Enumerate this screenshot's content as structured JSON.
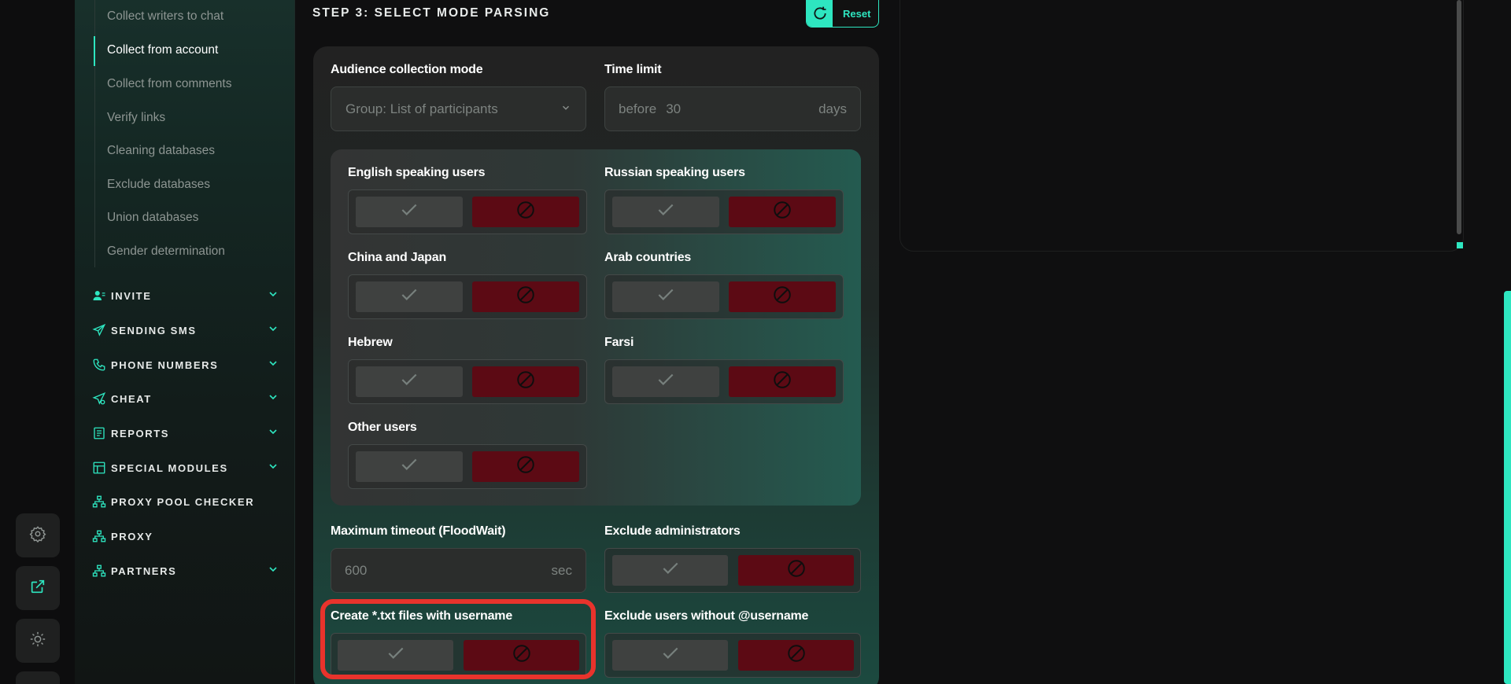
{
  "sidebar": {
    "sub_items": [
      {
        "label": "Collect writers to chat",
        "active": false
      },
      {
        "label": "Collect from account",
        "active": true
      },
      {
        "label": "Collect from comments",
        "active": false
      },
      {
        "label": "Verify links",
        "active": false
      },
      {
        "label": "Cleaning databases",
        "active": false
      },
      {
        "label": "Exclude databases",
        "active": false
      },
      {
        "label": "Union databases",
        "active": false
      },
      {
        "label": "Gender determination",
        "active": false
      }
    ],
    "sections": [
      {
        "label": "INVITE",
        "icon": "user-icon",
        "has_chevron": true
      },
      {
        "label": "SENDING SMS",
        "icon": "paper-plane-icon",
        "has_chevron": true
      },
      {
        "label": "PHONE NUMBERS",
        "icon": "phone-icon",
        "has_chevron": true
      },
      {
        "label": "CHEAT",
        "icon": "send-icon",
        "has_chevron": true
      },
      {
        "label": "REPORTS",
        "icon": "report-icon",
        "has_chevron": true
      },
      {
        "label": "SPECIAL MODULES",
        "icon": "modules-icon",
        "has_chevron": true
      },
      {
        "label": "PROXY POOL CHECKER",
        "icon": "network-icon",
        "has_chevron": false
      },
      {
        "label": "PROXY",
        "icon": "network-icon",
        "has_chevron": false
      },
      {
        "label": "PARTNERS",
        "icon": "network-icon",
        "has_chevron": true
      }
    ]
  },
  "rail": {
    "icons": [
      "gear-icon",
      "external-link-icon",
      "sun-icon"
    ]
  },
  "main": {
    "step_title": "STEP 3: SELECT MODE PARSING",
    "reset_label": "Reset",
    "audience_mode": {
      "label": "Audience collection mode",
      "value": "Group: List of participants"
    },
    "time_limit": {
      "label": "Time limit",
      "prefix": "before",
      "value": "30",
      "suffix": "days"
    },
    "languages": [
      {
        "label": "English speaking users"
      },
      {
        "label": "Russian speaking users"
      },
      {
        "label": "China and Japan"
      },
      {
        "label": "Arab countries"
      },
      {
        "label": "Hebrew"
      },
      {
        "label": "Farsi"
      },
      {
        "label": "Other users"
      }
    ],
    "max_timeout": {
      "label": "Maximum timeout (FloodWait)",
      "value": "600",
      "suffix": "sec"
    },
    "exclude_admins": {
      "label": "Exclude administrators"
    },
    "create_txt": {
      "label": "Create *.txt files with username"
    },
    "exclude_no_username": {
      "label": "Exclude users without @username"
    }
  },
  "colors": {
    "accent": "#2ee6c0",
    "deny": "#5c0a14",
    "highlight": "#e8332c"
  }
}
